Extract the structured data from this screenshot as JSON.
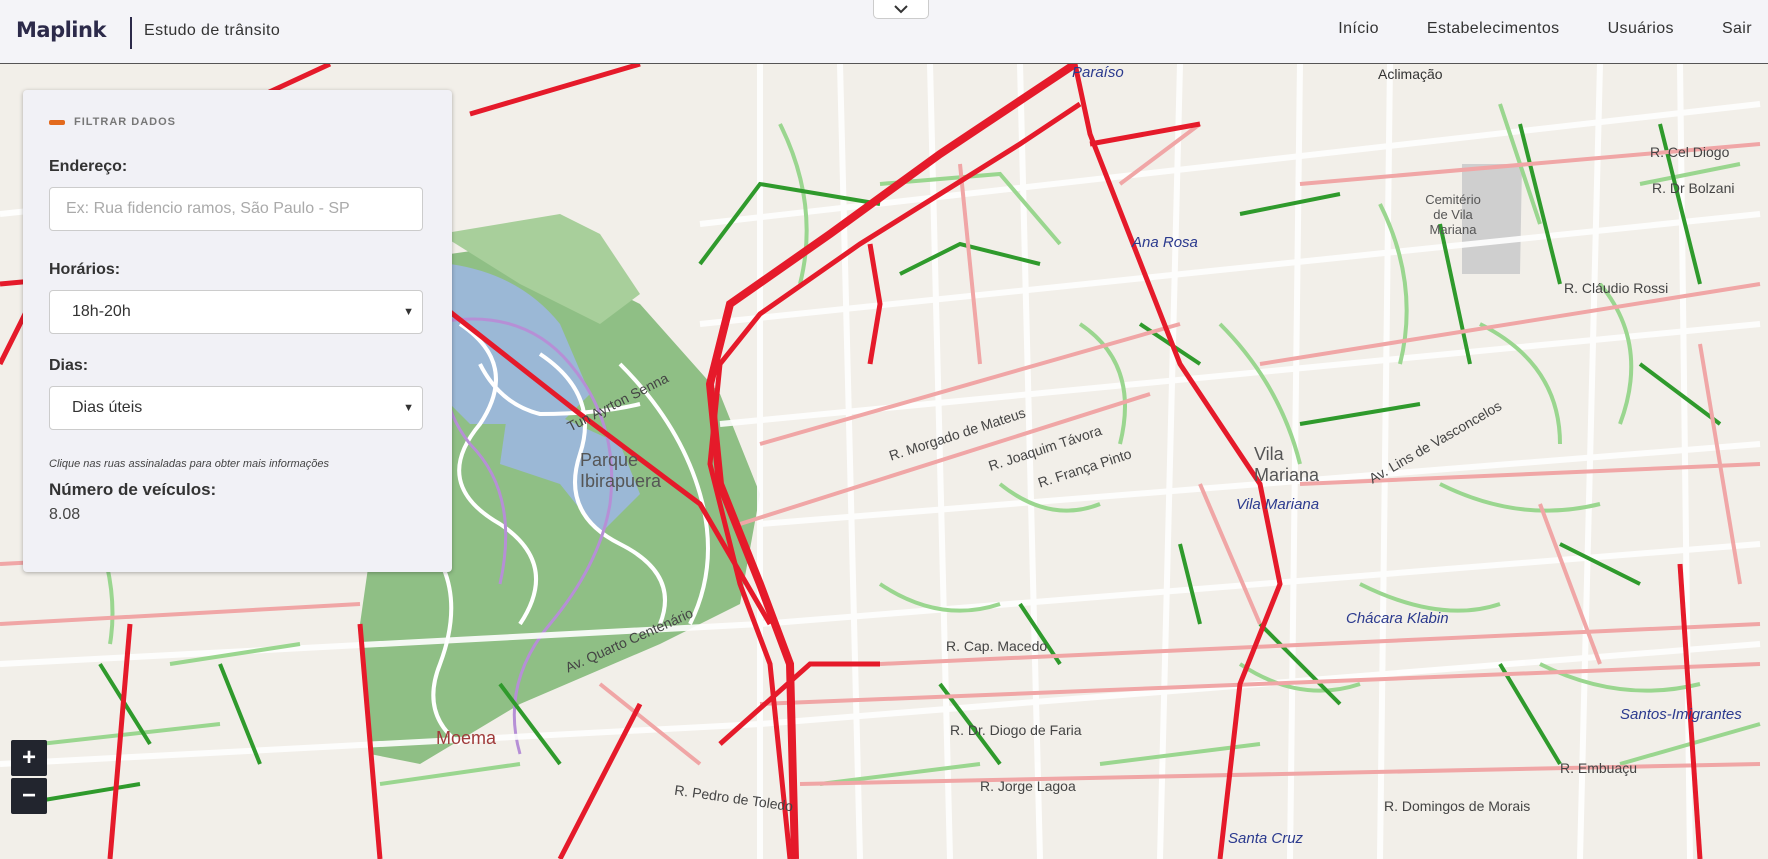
{
  "header": {
    "brand": "Maplink",
    "app_title": "Estudo de trânsito",
    "nav": [
      "Início",
      "Estabelecimentos",
      "Usuários",
      "Sair"
    ]
  },
  "panel": {
    "title": "FILTRAR DADOS",
    "address_label": "Endereço:",
    "address_placeholder": "Ex: Rua fidencio ramos, São Paulo - SP",
    "hours_label": "Horários:",
    "hours_value": "18h-20h",
    "days_label": "Dias:",
    "days_value": "Dias úteis",
    "hint": "Clique nas ruas assinaladas para obter mais informações",
    "vehicles_label": "Número de veículos:",
    "vehicles_value": "8.08"
  },
  "map": {
    "zoom_in": "+",
    "zoom_out": "−",
    "labels": {
      "paraiso": "Paraíso",
      "aclimacao": "Aclimação",
      "cemiterio": "Cemitério de Vila Mariana",
      "ana_rosa": "Ana Rosa",
      "tun_ayrton": "Tun Ayrton Senna",
      "parque": "Parque Ibirapuera",
      "vila_mariana_district": "Vila Mariana",
      "vila_mariana_station": "Vila Mariana",
      "chacara": "Chácara Klabin",
      "santos_imigrantes": "Santos-Imigrantes",
      "moema": "Moema",
      "santa_cruz": "Santa Cruz",
      "r_morgado": "R. Morgado de Mateus",
      "r_joaquim": "R. Joaquim Távora",
      "r_franca_pinto": "R. França Pinto",
      "r_capitao": "R. Cap. Macedo",
      "r_diogo": "R. Dr. Diogo de Faria",
      "r_jorge": "R. Jorge Lagoa",
      "r_pedro": "R. Pedro de Toledo",
      "av_lins": "Av. Lins de Vasconcelos",
      "r_domingos": "R. Domingos de Morais",
      "r_cel": "R. Cel Diogo",
      "r_dr_bolzani": "R. Dr Bolzani",
      "r_claudio": "R. Cláudio Rossi",
      "r_embuacu": "R. Embuaçu",
      "av_quarto": "Av. Quarto Centenário"
    }
  }
}
